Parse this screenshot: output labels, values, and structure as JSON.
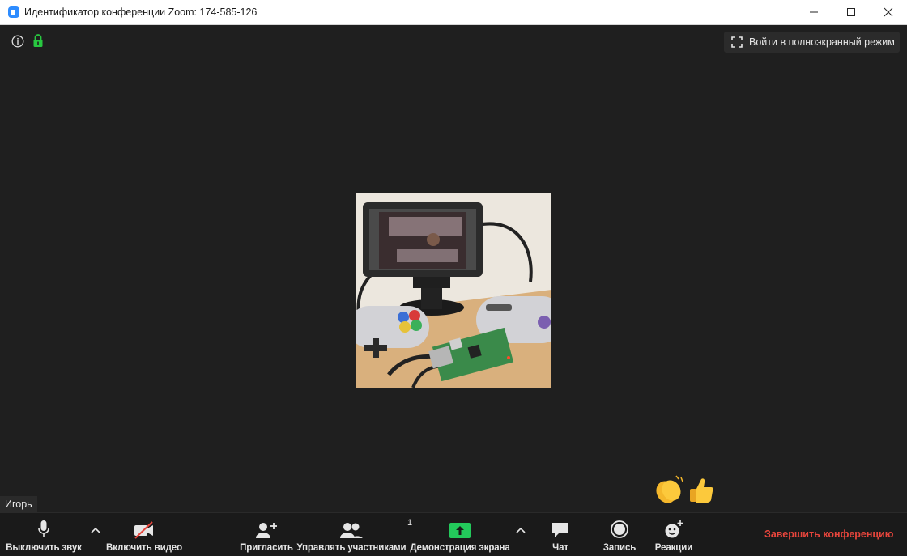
{
  "window": {
    "title": "Идентификатор конференции Zoom: 174-585-126"
  },
  "top_overlay": {
    "fullscreen_label": "Войти в полноэкранный режим"
  },
  "participant": {
    "name": "Игорь"
  },
  "toolbar": {
    "mute_label": "Выключить звук",
    "video_label": "Включить видео",
    "invite_label": "Пригласить",
    "participants_label": "Управлять участниками",
    "participants_count": "1",
    "share_label": "Демонстрация экрана",
    "chat_label": "Чат",
    "record_label": "Запись",
    "reactions_label": "Реакции",
    "end_label": "Завершить конференцию"
  },
  "colors": {
    "accent_blue": "#2d8cff",
    "share_green": "#23c95b",
    "end_red": "#e8453c",
    "lock_green": "#28c840"
  },
  "icons": {
    "info": "info-icon",
    "lock": "lock-icon",
    "fullscreen": "fullscreen-icon",
    "mic": "microphone-icon",
    "video_off": "video-off-icon",
    "invite": "add-user-icon",
    "participants": "participants-icon",
    "share": "share-screen-icon",
    "chat": "chat-icon",
    "record": "record-icon",
    "reactions": "reaction-icon"
  }
}
